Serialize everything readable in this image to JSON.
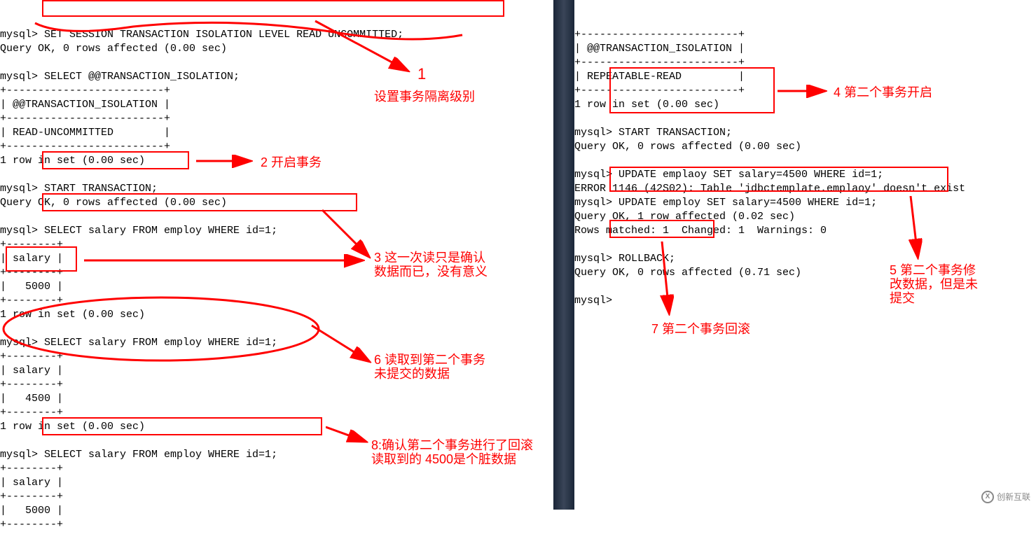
{
  "left_terminal": {
    "lines": [
      "mysql> SET SESSION TRANSACTION ISOLATION LEVEL READ UNCOMMITTED;",
      "Query OK, 0 rows affected (0.00 sec)",
      "",
      "mysql> SELECT @@TRANSACTION_ISOLATION;",
      "+-------------------------+",
      "| @@TRANSACTION_ISOLATION |",
      "+-------------------------+",
      "| READ-UNCOMMITTED        |",
      "+-------------------------+",
      "1 row in set (0.00 sec)",
      "",
      "mysql> START TRANSACTION;",
      "Query OK, 0 rows affected (0.00 sec)",
      "",
      "mysql> SELECT salary FROM employ WHERE id=1;",
      "+--------+",
      "| salary |",
      "+--------+",
      "|   5000 |",
      "+--------+",
      "1 row in set (0.00 sec)",
      "",
      "mysql> SELECT salary FROM employ WHERE id=1;",
      "+--------+",
      "| salary |",
      "+--------+",
      "|   4500 |",
      "+--------+",
      "1 row in set (0.00 sec)",
      "",
      "mysql> SELECT salary FROM employ WHERE id=1;",
      "+--------+",
      "| salary |",
      "+--------+",
      "|   5000 |",
      "+--------+"
    ]
  },
  "right_terminal": {
    "lines": [
      "+-------------------------+",
      "| @@TRANSACTION_ISOLATION |",
      "+-------------------------+",
      "| REPEATABLE-READ         |",
      "+-------------------------+",
      "1 row in set (0.00 sec)",
      "",
      "mysql> START TRANSACTION;",
      "Query OK, 0 rows affected (0.00 sec)",
      "",
      "mysql> UPDATE emplaoy SET salary=4500 WHERE id=1;",
      "ERROR 1146 (42S02): Table 'jdbctemplate.emplaoy' doesn't exist",
      "mysql> UPDATE employ SET salary=4500 WHERE id=1;",
      "Query OK, 1 row affected (0.02 sec)",
      "Rows matched: 1  Changed: 1  Warnings: 0",
      "",
      "mysql> ROLLBACK;",
      "Query OK, 0 rows affected (0.71 sec)",
      "",
      "mysql>"
    ]
  },
  "annotations": {
    "a1_num": "1",
    "a1_text": "设置事务隔离级别",
    "a2": "2 开启事务",
    "a3": "3 这一次读只是确认\n数据而已，没有意义",
    "a4": "4 第二个事务开启",
    "a5": "5 第二个事务修\n改数据，但是未\n提交",
    "a6": "6 读取到第二个事务\n未提交的数据",
    "a7": "7 第二个事务回滚",
    "a8": "8:确认第二个事务进行了回滚\n读取到的 4500是个脏数据"
  },
  "watermark": "创新互联"
}
